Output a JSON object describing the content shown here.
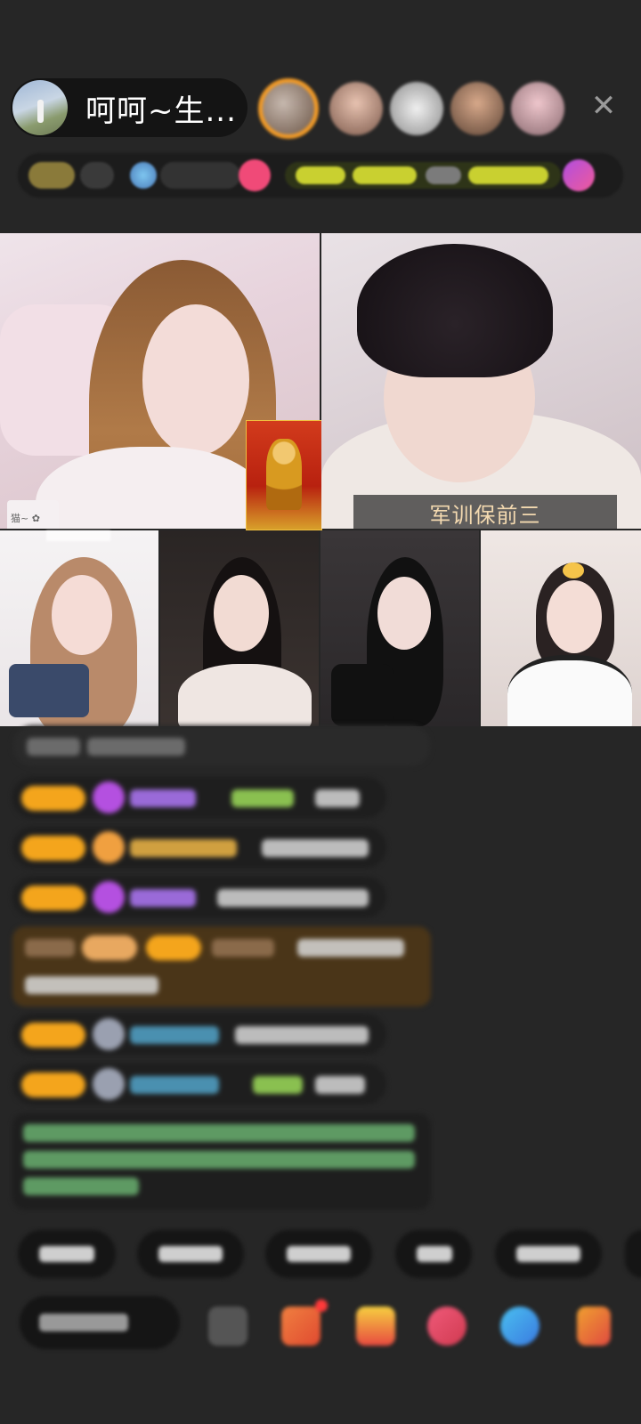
{
  "header": {
    "host_name": "呵呵~生...",
    "close_icon": "close-icon"
  },
  "stream": {
    "guest_caption": "军训保前三"
  },
  "colors": {
    "background": "#262626",
    "badge_orange": "#f4a51c",
    "caption_text": "#f3d9b0",
    "viewer_ring": "#f09a28"
  }
}
